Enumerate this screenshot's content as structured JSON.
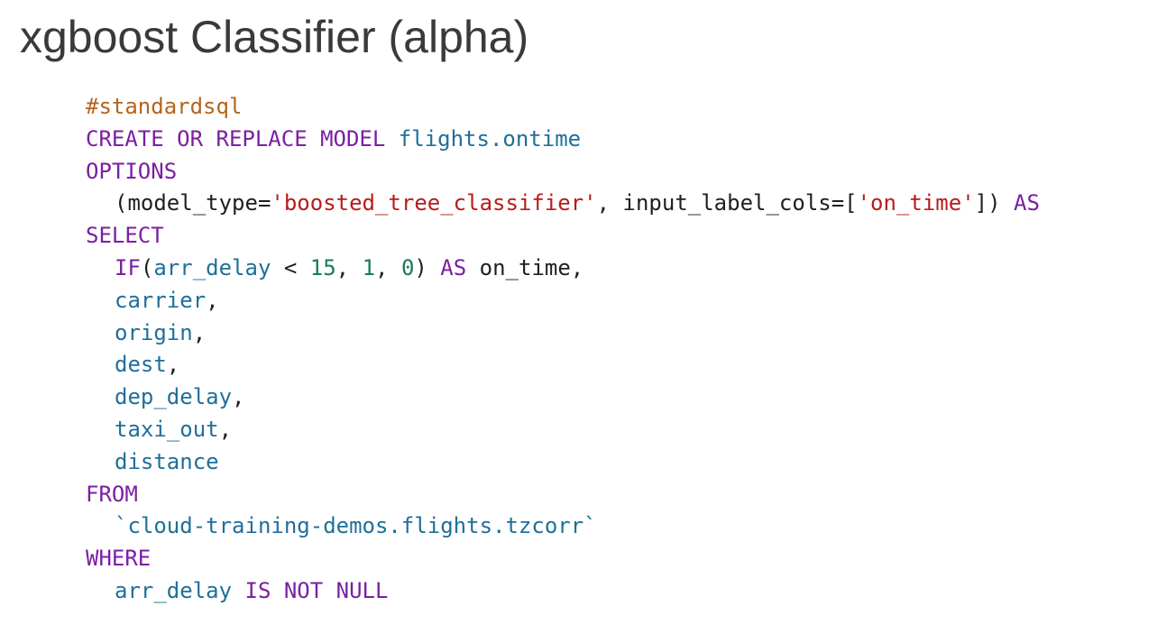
{
  "title": "xgboost Classifier (alpha)",
  "code": {
    "comment": "#standardsql",
    "line2": {
      "kw": "CREATE OR REPLACE MODEL",
      "model_name": "flights.ontime"
    },
    "line3": {
      "kw": "OPTIONS"
    },
    "line4": {
      "open": "(model_type=",
      "model_type_value": "'boosted_tree_classifier'",
      "mid": ", input_label_cols=[",
      "label_value": "'on_time'",
      "close": "])",
      "kw_as": "AS"
    },
    "line5": {
      "kw": "SELECT"
    },
    "line6": {
      "fn": "IF",
      "paren_open": "(",
      "col": "arr_delay",
      "op": " < ",
      "n1": "15",
      "c1": ", ",
      "n2": "1",
      "c2": ", ",
      "n3": "0",
      "paren_close": ")",
      "kw_as": "AS",
      "alias": "on_time,"
    },
    "columns": [
      {
        "name": "carrier",
        "suffix": ","
      },
      {
        "name": "origin",
        "suffix": ","
      },
      {
        "name": "dest",
        "suffix": ","
      },
      {
        "name": "dep_delay",
        "suffix": ","
      },
      {
        "name": "taxi_out",
        "suffix": ","
      },
      {
        "name": "distance",
        "suffix": ""
      }
    ],
    "from_kw": "FROM",
    "table": "`cloud-training-demos.flights.tzcorr`",
    "where_kw": "WHERE",
    "where_col": "arr_delay",
    "where_cond": "IS NOT NULL"
  },
  "colors": {
    "keyword": "#7b1fa2",
    "identifier": "#1f6f9a",
    "string": "#b71c1c",
    "number": "#1b7a5a",
    "comment": "#b5651d"
  }
}
